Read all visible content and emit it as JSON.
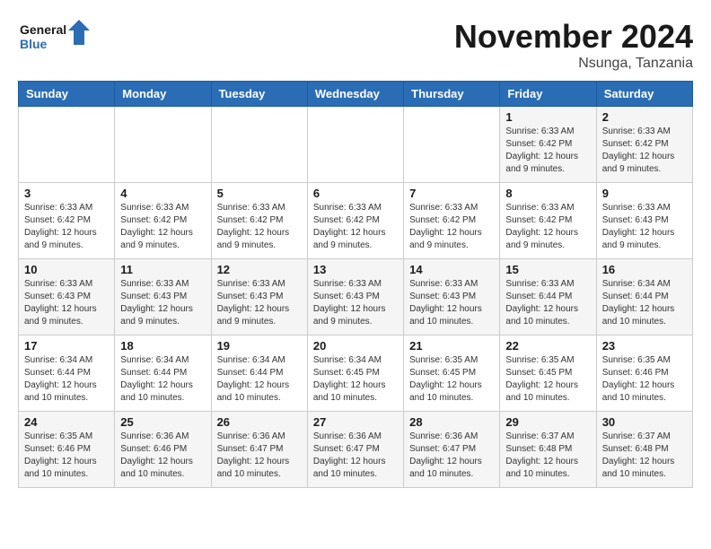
{
  "logo": {
    "line1": "General",
    "line2": "Blue"
  },
  "title": "November 2024",
  "location": "Nsunga, Tanzania",
  "weekdays": [
    "Sunday",
    "Monday",
    "Tuesday",
    "Wednesday",
    "Thursday",
    "Friday",
    "Saturday"
  ],
  "weeks": [
    [
      {
        "day": "",
        "info": ""
      },
      {
        "day": "",
        "info": ""
      },
      {
        "day": "",
        "info": ""
      },
      {
        "day": "",
        "info": ""
      },
      {
        "day": "",
        "info": ""
      },
      {
        "day": "1",
        "info": "Sunrise: 6:33 AM\nSunset: 6:42 PM\nDaylight: 12 hours\nand 9 minutes."
      },
      {
        "day": "2",
        "info": "Sunrise: 6:33 AM\nSunset: 6:42 PM\nDaylight: 12 hours\nand 9 minutes."
      }
    ],
    [
      {
        "day": "3",
        "info": "Sunrise: 6:33 AM\nSunset: 6:42 PM\nDaylight: 12 hours\nand 9 minutes."
      },
      {
        "day": "4",
        "info": "Sunrise: 6:33 AM\nSunset: 6:42 PM\nDaylight: 12 hours\nand 9 minutes."
      },
      {
        "day": "5",
        "info": "Sunrise: 6:33 AM\nSunset: 6:42 PM\nDaylight: 12 hours\nand 9 minutes."
      },
      {
        "day": "6",
        "info": "Sunrise: 6:33 AM\nSunset: 6:42 PM\nDaylight: 12 hours\nand 9 minutes."
      },
      {
        "day": "7",
        "info": "Sunrise: 6:33 AM\nSunset: 6:42 PM\nDaylight: 12 hours\nand 9 minutes."
      },
      {
        "day": "8",
        "info": "Sunrise: 6:33 AM\nSunset: 6:42 PM\nDaylight: 12 hours\nand 9 minutes."
      },
      {
        "day": "9",
        "info": "Sunrise: 6:33 AM\nSunset: 6:43 PM\nDaylight: 12 hours\nand 9 minutes."
      }
    ],
    [
      {
        "day": "10",
        "info": "Sunrise: 6:33 AM\nSunset: 6:43 PM\nDaylight: 12 hours\nand 9 minutes."
      },
      {
        "day": "11",
        "info": "Sunrise: 6:33 AM\nSunset: 6:43 PM\nDaylight: 12 hours\nand 9 minutes."
      },
      {
        "day": "12",
        "info": "Sunrise: 6:33 AM\nSunset: 6:43 PM\nDaylight: 12 hours\nand 9 minutes."
      },
      {
        "day": "13",
        "info": "Sunrise: 6:33 AM\nSunset: 6:43 PM\nDaylight: 12 hours\nand 9 minutes."
      },
      {
        "day": "14",
        "info": "Sunrise: 6:33 AM\nSunset: 6:43 PM\nDaylight: 12 hours\nand 10 minutes."
      },
      {
        "day": "15",
        "info": "Sunrise: 6:33 AM\nSunset: 6:44 PM\nDaylight: 12 hours\nand 10 minutes."
      },
      {
        "day": "16",
        "info": "Sunrise: 6:34 AM\nSunset: 6:44 PM\nDaylight: 12 hours\nand 10 minutes."
      }
    ],
    [
      {
        "day": "17",
        "info": "Sunrise: 6:34 AM\nSunset: 6:44 PM\nDaylight: 12 hours\nand 10 minutes."
      },
      {
        "day": "18",
        "info": "Sunrise: 6:34 AM\nSunset: 6:44 PM\nDaylight: 12 hours\nand 10 minutes."
      },
      {
        "day": "19",
        "info": "Sunrise: 6:34 AM\nSunset: 6:44 PM\nDaylight: 12 hours\nand 10 minutes."
      },
      {
        "day": "20",
        "info": "Sunrise: 6:34 AM\nSunset: 6:45 PM\nDaylight: 12 hours\nand 10 minutes."
      },
      {
        "day": "21",
        "info": "Sunrise: 6:35 AM\nSunset: 6:45 PM\nDaylight: 12 hours\nand 10 minutes."
      },
      {
        "day": "22",
        "info": "Sunrise: 6:35 AM\nSunset: 6:45 PM\nDaylight: 12 hours\nand 10 minutes."
      },
      {
        "day": "23",
        "info": "Sunrise: 6:35 AM\nSunset: 6:46 PM\nDaylight: 12 hours\nand 10 minutes."
      }
    ],
    [
      {
        "day": "24",
        "info": "Sunrise: 6:35 AM\nSunset: 6:46 PM\nDaylight: 12 hours\nand 10 minutes."
      },
      {
        "day": "25",
        "info": "Sunrise: 6:36 AM\nSunset: 6:46 PM\nDaylight: 12 hours\nand 10 minutes."
      },
      {
        "day": "26",
        "info": "Sunrise: 6:36 AM\nSunset: 6:47 PM\nDaylight: 12 hours\nand 10 minutes."
      },
      {
        "day": "27",
        "info": "Sunrise: 6:36 AM\nSunset: 6:47 PM\nDaylight: 12 hours\nand 10 minutes."
      },
      {
        "day": "28",
        "info": "Sunrise: 6:36 AM\nSunset: 6:47 PM\nDaylight: 12 hours\nand 10 minutes."
      },
      {
        "day": "29",
        "info": "Sunrise: 6:37 AM\nSunset: 6:48 PM\nDaylight: 12 hours\nand 10 minutes."
      },
      {
        "day": "30",
        "info": "Sunrise: 6:37 AM\nSunset: 6:48 PM\nDaylight: 12 hours\nand 10 minutes."
      }
    ]
  ]
}
